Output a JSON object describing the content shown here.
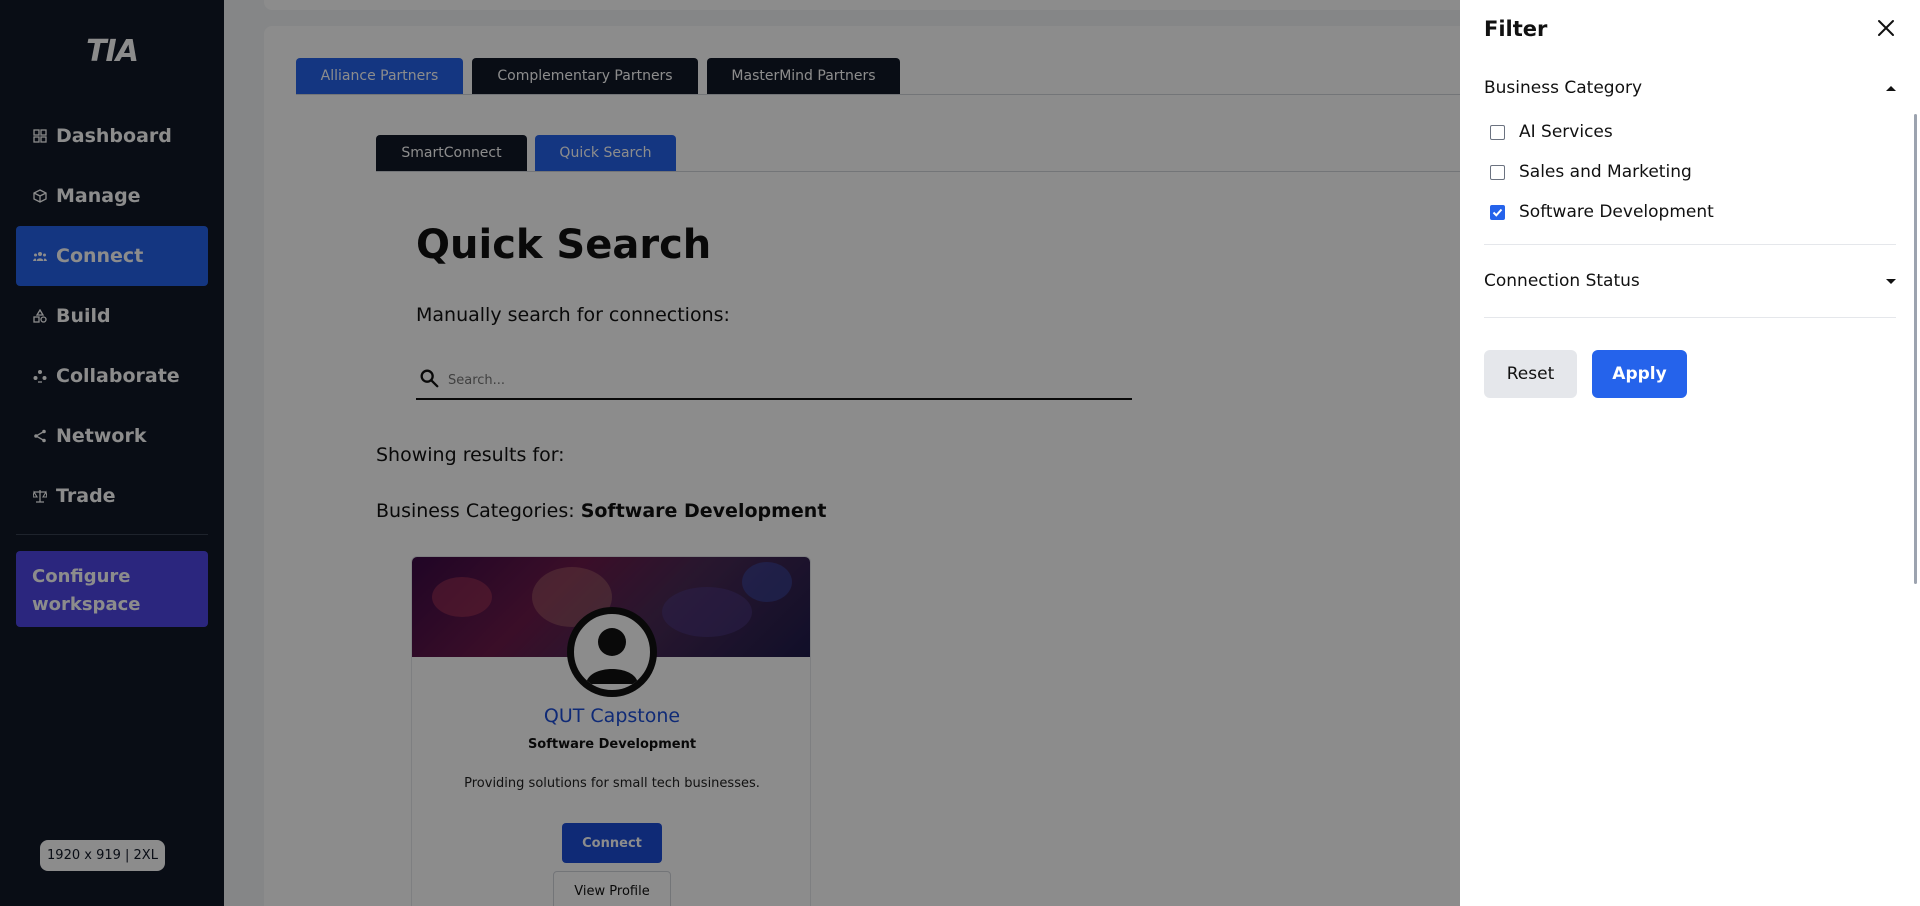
{
  "sidebar": {
    "logo": "TIA",
    "items": [
      {
        "label": "Dashboard",
        "icon": "grid-icon"
      },
      {
        "label": "Manage",
        "icon": "box-icon"
      },
      {
        "label": "Connect",
        "icon": "users-icon",
        "active": true
      },
      {
        "label": "Build",
        "icon": "shapes-icon"
      },
      {
        "label": "Collaborate",
        "icon": "team-icon"
      },
      {
        "label": "Network",
        "icon": "share-icon"
      },
      {
        "label": "Trade",
        "icon": "scale-icon"
      }
    ],
    "configure_label": "Configure workspace",
    "size_badge": "1920 x 919  |  2XL"
  },
  "main": {
    "partner_tabs": [
      "Alliance Partners",
      "Complementary Partners",
      "MasterMind Partners"
    ],
    "sub_tabs": [
      "SmartConnect",
      "Quick Search"
    ],
    "title": "Quick Search",
    "subtitle": "Manually search for connections:",
    "search": {
      "placeholder": "Search..."
    },
    "showing_results": "Showing results for:",
    "categories_prefix": "Business Categories:",
    "categories_value": "Software Development",
    "result": {
      "name": "QUT Capstone",
      "category": "Software Development",
      "description": "Providing solutions for small tech businesses.",
      "connect_label": "Connect",
      "view_label": "View Profile"
    }
  },
  "filter": {
    "title": "Filter",
    "business_category": {
      "label": "Business Category",
      "options": [
        {
          "label": "AI Services",
          "checked": false
        },
        {
          "label": "Sales and Marketing",
          "checked": false
        },
        {
          "label": "Software Development",
          "checked": true
        }
      ]
    },
    "connection_status": {
      "label": "Connection Status"
    },
    "reset_label": "Reset",
    "apply_label": "Apply"
  },
  "colors": {
    "sidebar_bg": "#111827",
    "accent": "#2563eb",
    "configure_bg": "#4f46e5"
  }
}
